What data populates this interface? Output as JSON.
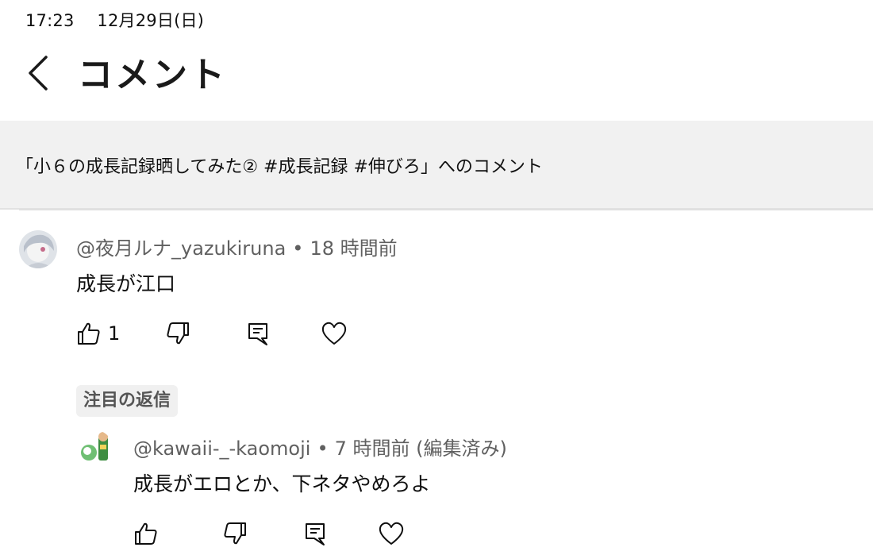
{
  "status_bar": {
    "time": "17:23",
    "date": "12月29日(日)"
  },
  "header": {
    "title": "コメント"
  },
  "video_ref": {
    "text": "「小６の成長記録晒してみた② #成長記録 #伸びろ」へのコメント"
  },
  "comments": [
    {
      "author": "@夜月ルナ_yazukiruna",
      "separator": "•",
      "time": "18 時間前",
      "text": "成長が江口",
      "likes": "1",
      "pinned_label": "注目の返信",
      "reply": {
        "author": "@kawaii-_-kaomoji",
        "separator": "•",
        "time": "7 時間前 (編集済み)",
        "text": "成長がエロとか、下ネタやめろよ"
      }
    }
  ],
  "icons": {
    "back": "chevron-left-icon",
    "like": "thumbs-up-icon",
    "dislike": "thumbs-down-icon",
    "reply": "comment-icon",
    "heart": "heart-icon"
  },
  "colors": {
    "meta": "#606060",
    "panel": "#f1f1f1",
    "badge_bg": "#f0f0f0"
  }
}
